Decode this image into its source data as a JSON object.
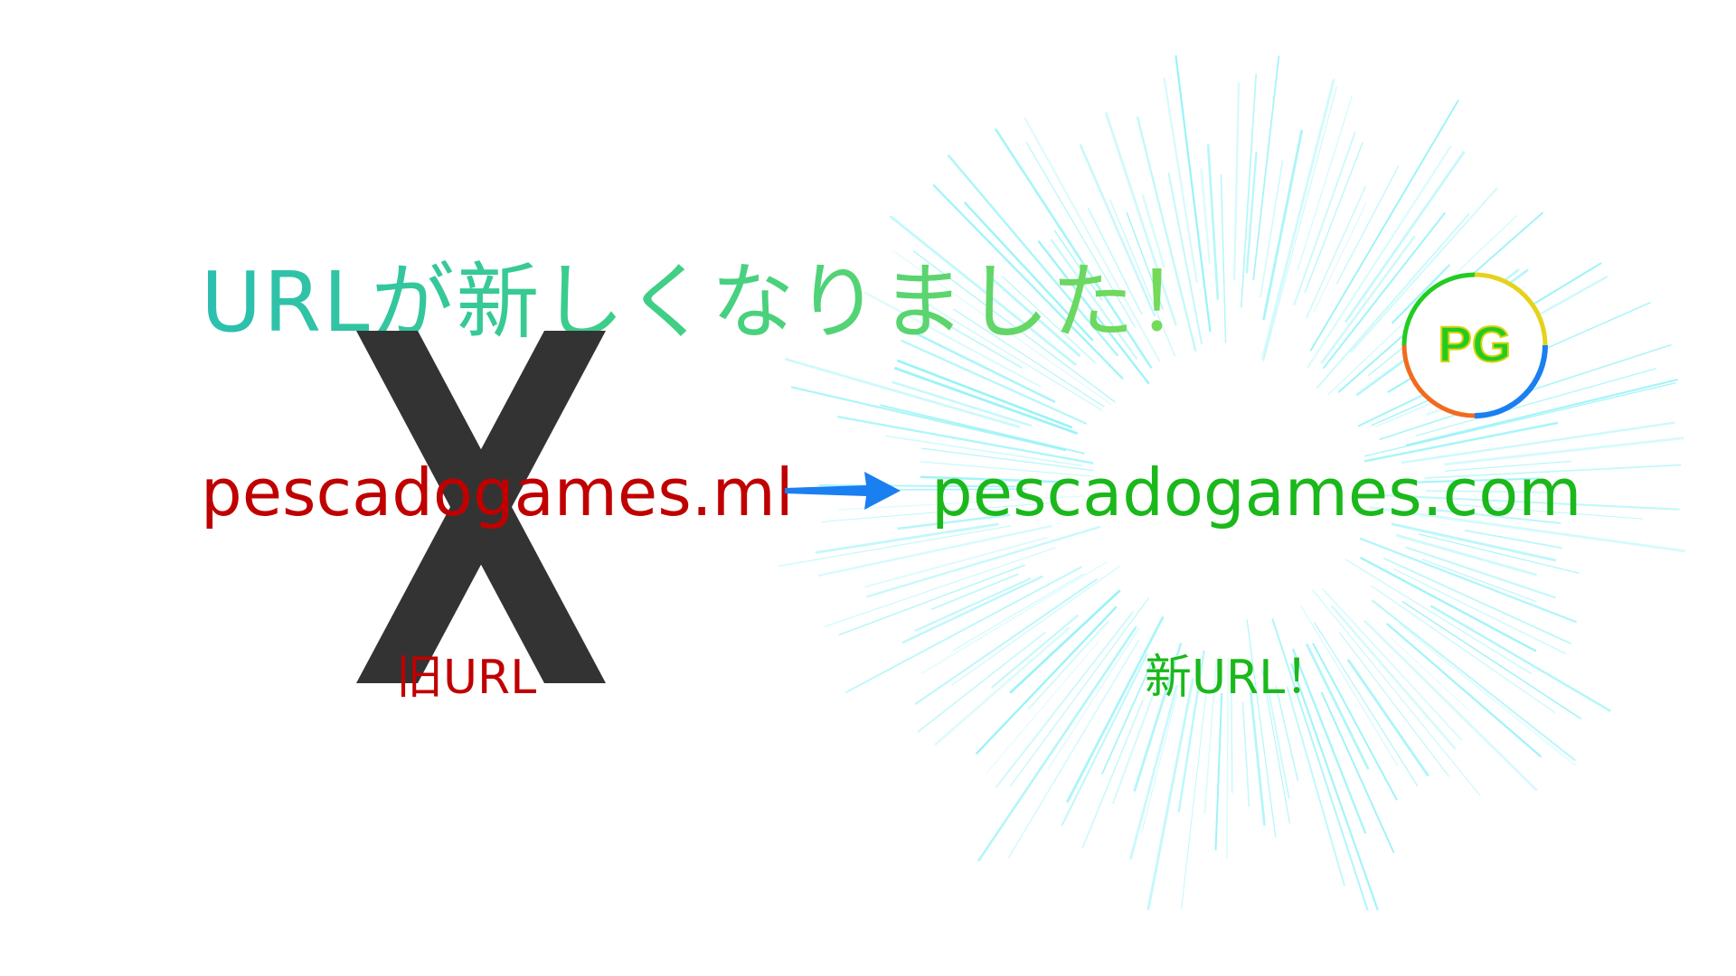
{
  "headline": "URLが新しくなりました！",
  "old_url": "pescadogames.ml",
  "new_url": "pescadogames.com",
  "old_caption": "旧URL",
  "new_caption": "新URL！",
  "logo_text": "PG",
  "icons": {
    "cross": "x-mark-icon",
    "arrow": "arrow-right-icon",
    "logo": "pg-logo"
  },
  "colors": {
    "old": "#c00000",
    "new": "#1bb81b",
    "arrow": "#1a7ff0",
    "cross": "#333333",
    "burst": "#7ff0f5",
    "headline_start": "#2bbfb0",
    "headline_end": "#7adb55",
    "logo_text": "#22cc22",
    "logo_text_outline": "#d7d20a"
  }
}
